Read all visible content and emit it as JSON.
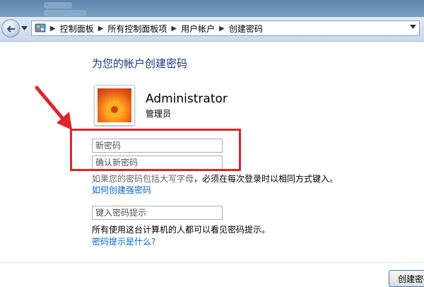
{
  "address_bar": {
    "breadcrumbs": [
      "控制面板",
      "所有控制面板项",
      "用户帐户",
      "创建密码"
    ]
  },
  "page": {
    "heading": "为您的帐户创建密码"
  },
  "user": {
    "name": "Administrator",
    "role": "管理员"
  },
  "form": {
    "new_password_placeholder": "新密码",
    "confirm_password_placeholder": "确认新密码",
    "hint_placeholder": "键入密码提示"
  },
  "notes": {
    "case_note_obscured": "如果您的密码包括大写字母",
    "case_note_visible": "，必须在每次登录时以相同方式键入。",
    "strong_password_link": "如何创建强密码",
    "hint_note": "所有使用这台计算机的人都可以看见密码提示。",
    "hint_link": "密码提示是什么?"
  },
  "buttons": {
    "create_password": "创建密码"
  },
  "colors": {
    "heading": "#1e3287",
    "link": "#0066cc",
    "annotation": "#e0242c"
  },
  "icons": [
    "back-arrow-icon",
    "control-panel-icon",
    "chevron-down-icon",
    "user-avatar-flower",
    "annotation-arrow"
  ]
}
